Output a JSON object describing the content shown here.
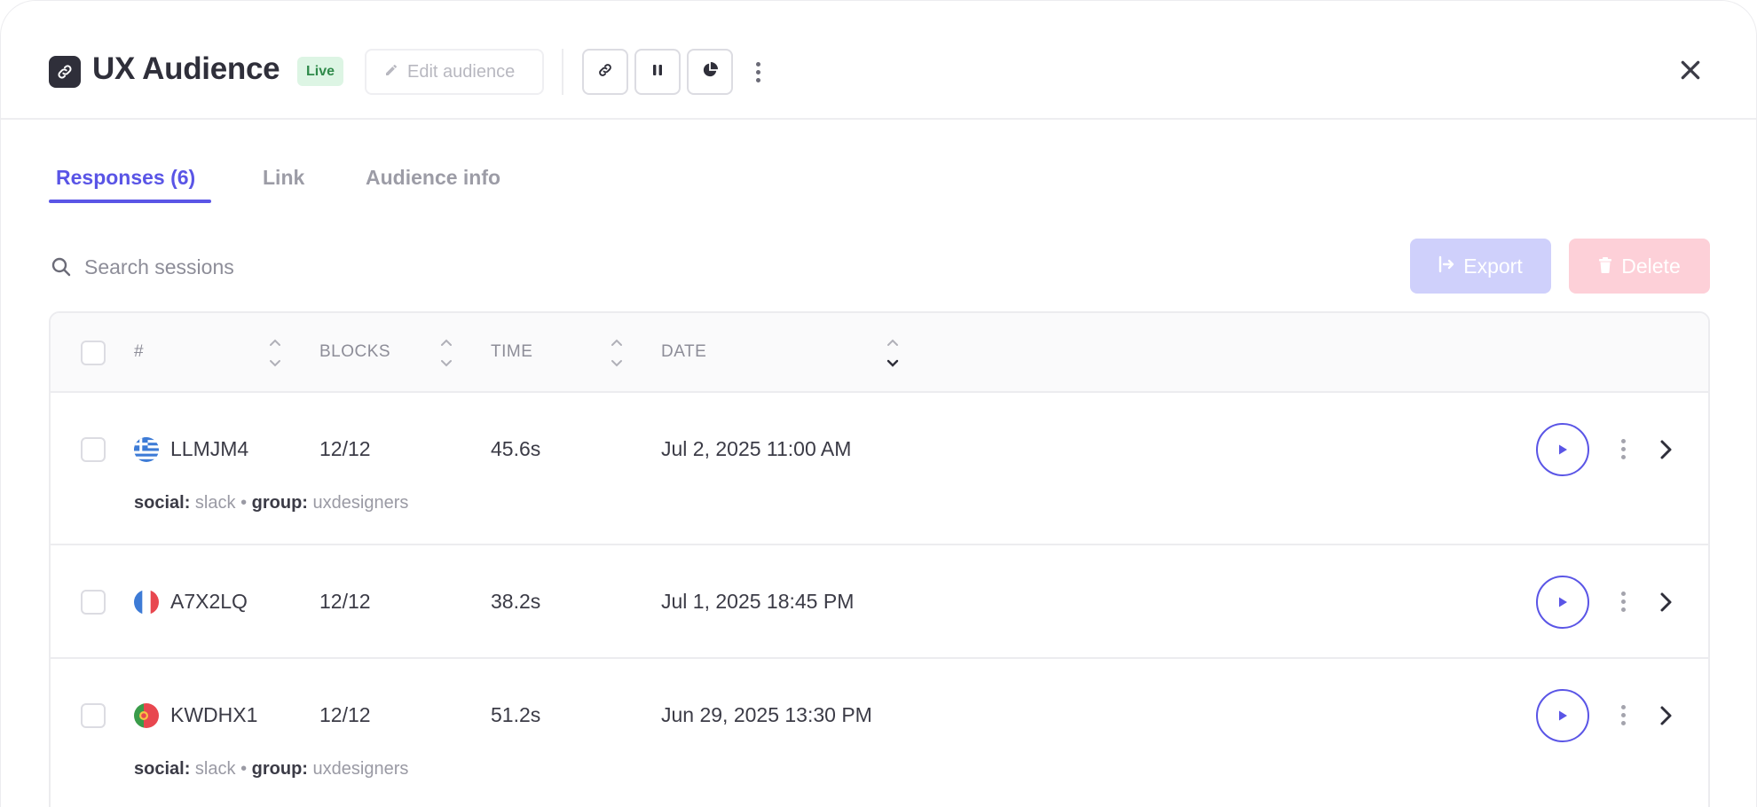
{
  "header": {
    "title": "UX Audience",
    "status_badge": "Live",
    "edit_label": "Edit audience",
    "app_icon": "link-icon",
    "tools": [
      "link-icon",
      "pause-icon",
      "pie-chart-icon"
    ],
    "more_icon": "more-vertical-icon",
    "close_icon": "close-icon"
  },
  "tabs": [
    {
      "label": "Responses (6)",
      "active": true
    },
    {
      "label": "Link",
      "active": false
    },
    {
      "label": "Audience info",
      "active": false
    }
  ],
  "search": {
    "placeholder": "Search sessions",
    "value": ""
  },
  "actions": {
    "export_label": "Export",
    "delete_label": "Delete"
  },
  "table": {
    "columns": [
      "#",
      "BLOCKS",
      "TIME",
      "DATE"
    ],
    "rows": [
      {
        "id": "LLMJM4",
        "flag": "greece",
        "blocks": "12/12",
        "time": "45.6s",
        "date": "Jul 2, 2025 11:00 AM",
        "meta": {
          "social_key": "social:",
          "social_val": "slack",
          "sep": "•",
          "group_key": "group:",
          "group_val": "uxdesigners"
        }
      },
      {
        "id": "A7X2LQ",
        "flag": "france",
        "blocks": "12/12",
        "time": "38.2s",
        "date": "Jul 1, 2025 18:45 PM"
      },
      {
        "id": "KWDHX1",
        "flag": "portugal",
        "blocks": "12/12",
        "time": "51.2s",
        "date": "Jun 29, 2025 13:30 PM",
        "meta": {
          "social_key": "social:",
          "social_val": "slack",
          "sep": "•",
          "group_key": "group:",
          "group_val": "uxdesigners"
        }
      }
    ]
  },
  "colors": {
    "accent": "#5a55e6",
    "live_bg": "#ddf5e4",
    "live_text": "#2f8a4a",
    "export_bg": "#cfd0fb",
    "delete_bg": "#fdd0d8"
  }
}
